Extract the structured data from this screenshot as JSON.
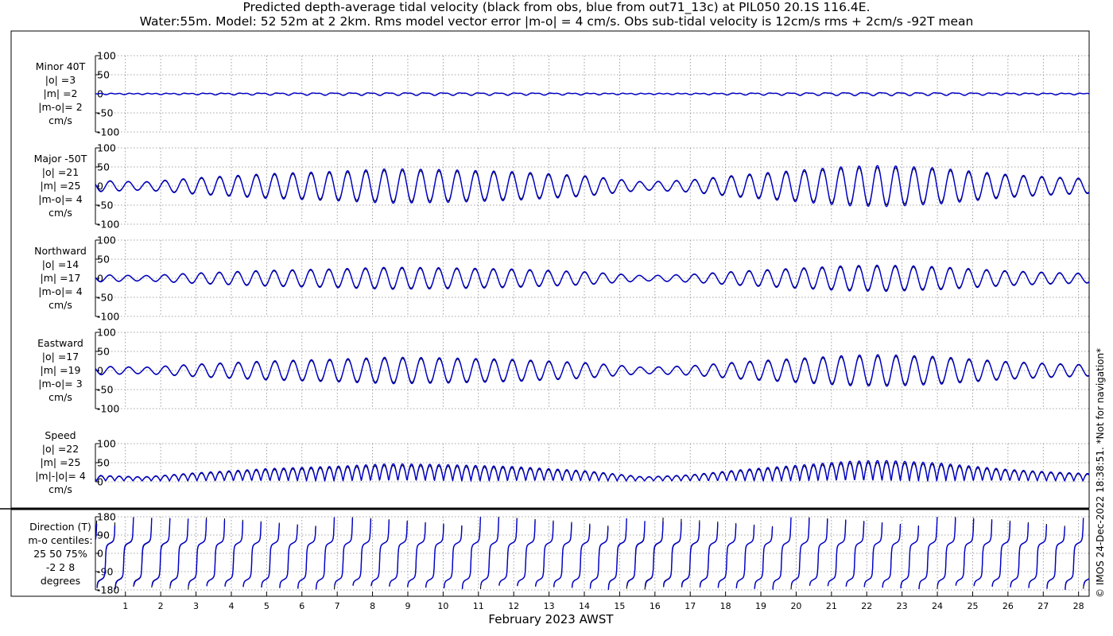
{
  "title": {
    "line1": "Predicted depth-average tidal velocity (black from obs, blue from out71_13c) at PIL050 20.1S 116.4E.",
    "line2": "Water:55m. Model: 52 52m at 2 2km. Rms model vector error |m-o| = 4 cm/s. Obs sub-tidal velocity is 12cm/s rms + 2cm/s -92T mean"
  },
  "footer_text": "© IMOS 24-Dec-2022 18:38:51. *Not for navigation*",
  "colors": {
    "obs": "#000000",
    "model": "#0000cc",
    "grid": "#888888"
  },
  "chart_data": {
    "type": "line",
    "xlabel": "February 2023 AWST",
    "x_ticks": [
      1,
      2,
      3,
      4,
      5,
      6,
      7,
      8,
      9,
      10,
      11,
      12,
      13,
      14,
      15,
      16,
      17,
      18,
      19,
      20,
      21,
      22,
      23,
      24,
      25,
      26,
      27,
      28
    ],
    "xlim": [
      0.15,
      28.3
    ],
    "series_names": [
      "obs",
      "out71_13c"
    ],
    "panels": [
      {
        "id": "minor",
        "labels": [
          "Minor 40T",
          "|o| =3",
          "|m| =2",
          "|m-o|= 2",
          "cm/s"
        ],
        "ylim": [
          -100,
          100
        ],
        "yticks": [
          100,
          50,
          0,
          -50,
          -100
        ],
        "ytick_labels": [
          "100",
          "50",
          "0",
          "-50",
          "-100"
        ],
        "kind": "minor",
        "obs_rms": 3,
        "model_rms": 2
      },
      {
        "id": "major",
        "labels": [
          "Major -50T",
          "|o| =21",
          "|m| =25",
          "|m-o|= 4",
          "cm/s"
        ],
        "ylim": [
          -100,
          100
        ],
        "yticks": [
          100,
          50,
          0,
          -50,
          -100
        ],
        "ytick_labels": [
          "100",
          "50",
          "0",
          "-50",
          "-100"
        ],
        "kind": "major",
        "obs_rms": 21,
        "model_rms": 25
      },
      {
        "id": "northward",
        "labels": [
          "Northward",
          "|o| =14",
          "|m| =17",
          "|m-o|= 4",
          "cm/s"
        ],
        "ylim": [
          -100,
          100
        ],
        "yticks": [
          100,
          50,
          0,
          -50,
          -100
        ],
        "ytick_labels": [
          "100",
          "50",
          "0",
          "-50",
          "-100"
        ],
        "kind": "north",
        "obs_rms": 14,
        "model_rms": 17
      },
      {
        "id": "eastward",
        "labels": [
          "Eastward",
          "|o| =17",
          "|m| =19",
          "|m-o|= 3",
          "cm/s"
        ],
        "ylim": [
          -100,
          100
        ],
        "yticks": [
          100,
          50,
          0,
          -50,
          -100
        ],
        "ytick_labels": [
          "100",
          "50",
          "0",
          "-50",
          "-100"
        ],
        "kind": "east",
        "obs_rms": 17,
        "model_rms": 19
      },
      {
        "id": "speed",
        "labels": [
          "Speed",
          "|o| =22",
          "|m| =25",
          "|m|-|o|= 4",
          "cm/s"
        ],
        "ylim": [
          0,
          100
        ],
        "yticks": [
          100,
          50,
          0
        ],
        "ytick_labels": [
          "100",
          "50",
          "0"
        ],
        "kind": "speed",
        "obs_rms": 22,
        "model_rms": 25
      },
      {
        "id": "direction",
        "labels": [
          "Direction (T)",
          "m-o centiles:",
          "25  50  75%",
          "-2  2  8",
          "degrees"
        ],
        "ylim": [
          -180,
          180
        ],
        "yticks": [
          180,
          90,
          0,
          -90,
          -180
        ],
        "ytick_labels": [
          "180",
          "90",
          "0",
          "-90",
          "-180"
        ],
        "kind": "direction"
      }
    ],
    "tidal_model": {
      "period_days": 0.5175,
      "amplitude_envelope_cm_s": [
        [
          0.15,
          14
        ],
        [
          1.5,
          10
        ],
        [
          3,
          20
        ],
        [
          5,
          30
        ],
        [
          7,
          36
        ],
        [
          8.5,
          42
        ],
        [
          10,
          40
        ],
        [
          12,
          35
        ],
        [
          14,
          25
        ],
        [
          15.7,
          10
        ],
        [
          17,
          15
        ],
        [
          18.5,
          28
        ],
        [
          20,
          38
        ],
        [
          21.5,
          48
        ],
        [
          22.5,
          50
        ],
        [
          24,
          44
        ],
        [
          26,
          28
        ],
        [
          27.2,
          22
        ],
        [
          28.3,
          18
        ]
      ]
    }
  }
}
